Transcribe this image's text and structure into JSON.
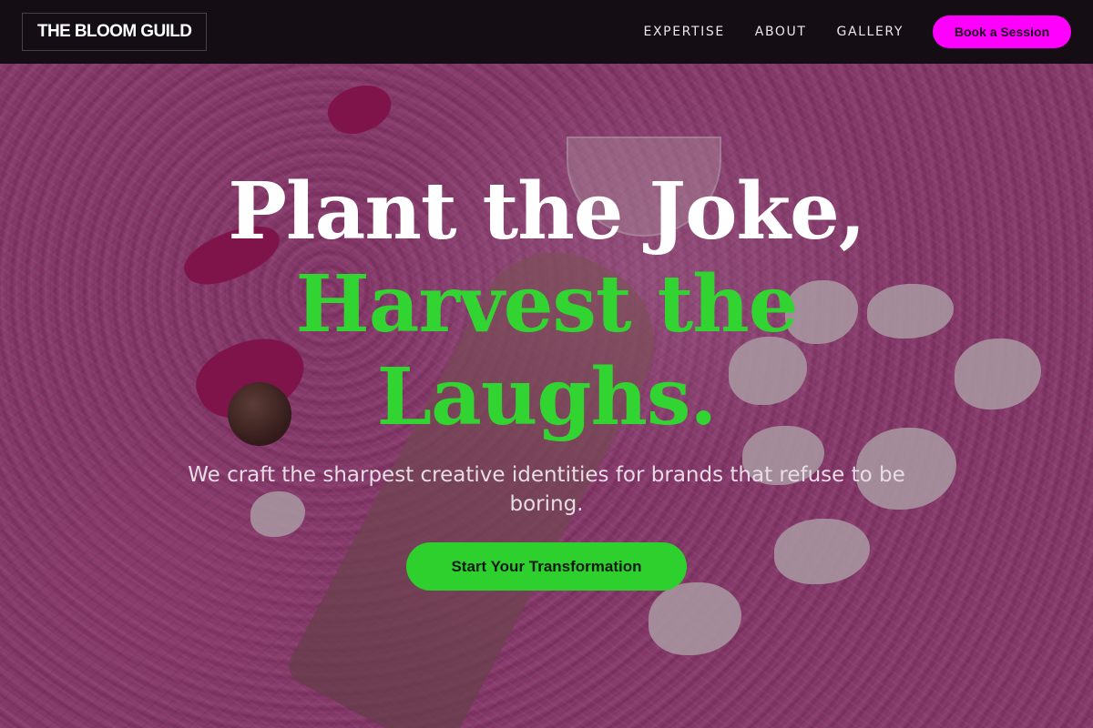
{
  "nav": {
    "logo": "THE BLOOM GUILD",
    "links": [
      "EXPERTISE",
      "ABOUT",
      "GALLERY"
    ],
    "cta": "Book a Session"
  },
  "hero": {
    "headline_line1": "Plant the Joke,",
    "headline_line2": "Harvest the Laughs.",
    "subtitle": "We craft the sharpest creative identities for brands that refuse to be boring.",
    "cta": "Start Your Transformation",
    "background_image": "pink fur flat-lay with hand, gold chains, candies, truffle and petals"
  },
  "colors": {
    "nav_bg": "#140d14",
    "accent_magenta": "#ff00ff",
    "accent_green": "#2ed02e",
    "headline_white": "#ffffff"
  }
}
